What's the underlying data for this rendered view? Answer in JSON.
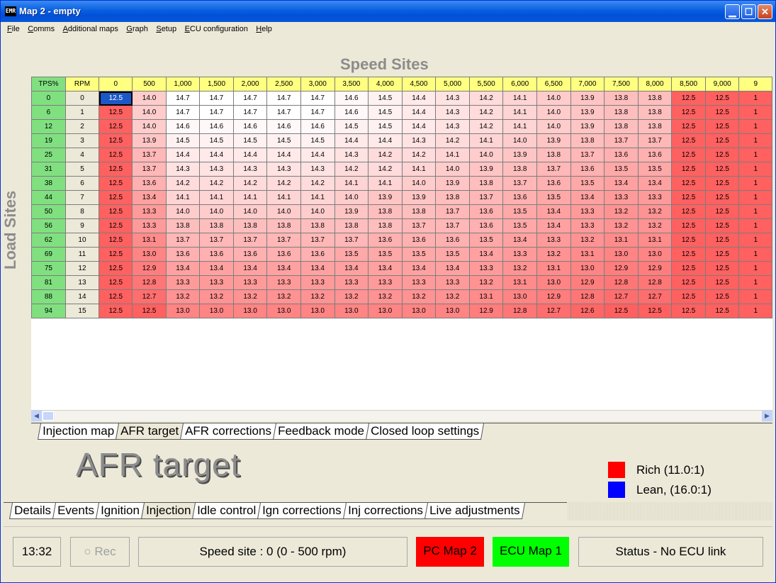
{
  "window": {
    "title": "Map 2 - empty",
    "icon_label": "EMR"
  },
  "menu": [
    "File",
    "Comms",
    "Additional maps",
    "Graph",
    "Setup",
    "ECU configuration",
    "Help"
  ],
  "headings": {
    "speed_sites": "Speed Sites",
    "load_sites": "Load Sites",
    "map_title": "AFR target"
  },
  "table": {
    "corner_tps": "TPS%",
    "corner_rpm": "RPM",
    "columns": [
      "0",
      "500",
      "1,000",
      "1,500",
      "2,000",
      "2,500",
      "3,000",
      "3,500",
      "4,000",
      "4,500",
      "5,000",
      "5,500",
      "6,000",
      "6,500",
      "7,000",
      "7,500",
      "8,000",
      "8,500",
      "9,000",
      "9"
    ],
    "rows": [
      {
        "tps": "0",
        "rpm": "0",
        "vals": [
          "12.5",
          "14.0",
          "14.7",
          "14.7",
          "14.7",
          "14.7",
          "14.7",
          "14.6",
          "14.5",
          "14.4",
          "14.3",
          "14.2",
          "14.1",
          "14.0",
          "13.9",
          "13.8",
          "13.8",
          "12.5",
          "12.5",
          "1"
        ]
      },
      {
        "tps": "6",
        "rpm": "1",
        "vals": [
          "12.5",
          "14.0",
          "14.7",
          "14.7",
          "14.7",
          "14.7",
          "14.7",
          "14.6",
          "14.5",
          "14.4",
          "14.3",
          "14.2",
          "14.1",
          "14.0",
          "13.9",
          "13.8",
          "13.8",
          "12.5",
          "12.5",
          "1"
        ]
      },
      {
        "tps": "12",
        "rpm": "2",
        "vals": [
          "12.5",
          "14.0",
          "14.6",
          "14.6",
          "14.6",
          "14.6",
          "14.6",
          "14.5",
          "14.5",
          "14.4",
          "14.3",
          "14.2",
          "14.1",
          "14.0",
          "13.9",
          "13.8",
          "13.8",
          "12.5",
          "12.5",
          "1"
        ]
      },
      {
        "tps": "19",
        "rpm": "3",
        "vals": [
          "12.5",
          "13.9",
          "14.5",
          "14.5",
          "14.5",
          "14.5",
          "14.5",
          "14.4",
          "14.4",
          "14.3",
          "14.2",
          "14.1",
          "14.0",
          "13.9",
          "13.8",
          "13.7",
          "13.7",
          "12.5",
          "12.5",
          "1"
        ]
      },
      {
        "tps": "25",
        "rpm": "4",
        "vals": [
          "12.5",
          "13.7",
          "14.4",
          "14.4",
          "14.4",
          "14.4",
          "14.4",
          "14.3",
          "14.2",
          "14.2",
          "14.1",
          "14.0",
          "13.9",
          "13.8",
          "13.7",
          "13.6",
          "13.6",
          "12.5",
          "12.5",
          "1"
        ]
      },
      {
        "tps": "31",
        "rpm": "5",
        "vals": [
          "12.5",
          "13.7",
          "14.3",
          "14.3",
          "14.3",
          "14.3",
          "14.3",
          "14.2",
          "14.2",
          "14.1",
          "14.0",
          "13.9",
          "13.8",
          "13.7",
          "13.6",
          "13.5",
          "13.5",
          "12.5",
          "12.5",
          "1"
        ]
      },
      {
        "tps": "38",
        "rpm": "6",
        "vals": [
          "12.5",
          "13.6",
          "14.2",
          "14.2",
          "14.2",
          "14.2",
          "14.2",
          "14.1",
          "14.1",
          "14.0",
          "13.9",
          "13.8",
          "13.7",
          "13.6",
          "13.5",
          "13.4",
          "13.4",
          "12.5",
          "12.5",
          "1"
        ]
      },
      {
        "tps": "44",
        "rpm": "7",
        "vals": [
          "12.5",
          "13.4",
          "14.1",
          "14.1",
          "14.1",
          "14.1",
          "14.1",
          "14.0",
          "13.9",
          "13.9",
          "13.8",
          "13.7",
          "13.6",
          "13.5",
          "13.4",
          "13.3",
          "13.3",
          "12.5",
          "12.5",
          "1"
        ]
      },
      {
        "tps": "50",
        "rpm": "8",
        "vals": [
          "12.5",
          "13.3",
          "14.0",
          "14.0",
          "14.0",
          "14.0",
          "14.0",
          "13.9",
          "13.8",
          "13.8",
          "13.7",
          "13.6",
          "13.5",
          "13.4",
          "13.3",
          "13.2",
          "13.2",
          "12.5",
          "12.5",
          "1"
        ]
      },
      {
        "tps": "56",
        "rpm": "9",
        "vals": [
          "12.5",
          "13.3",
          "13.8",
          "13.8",
          "13.8",
          "13.8",
          "13.8",
          "13.8",
          "13.8",
          "13.7",
          "13.7",
          "13.6",
          "13.5",
          "13.4",
          "13.3",
          "13.2",
          "13.2",
          "12.5",
          "12.5",
          "1"
        ]
      },
      {
        "tps": "62",
        "rpm": "10",
        "vals": [
          "12.5",
          "13.1",
          "13.7",
          "13.7",
          "13.7",
          "13.7",
          "13.7",
          "13.7",
          "13.6",
          "13.6",
          "13.6",
          "13.5",
          "13.4",
          "13.3",
          "13.2",
          "13.1",
          "13.1",
          "12.5",
          "12.5",
          "1"
        ]
      },
      {
        "tps": "69",
        "rpm": "11",
        "vals": [
          "12.5",
          "13.0",
          "13.6",
          "13.6",
          "13.6",
          "13.6",
          "13.6",
          "13.5",
          "13.5",
          "13.5",
          "13.5",
          "13.4",
          "13.3",
          "13.2",
          "13.1",
          "13.0",
          "13.0",
          "12.5",
          "12.5",
          "1"
        ]
      },
      {
        "tps": "75",
        "rpm": "12",
        "vals": [
          "12.5",
          "12.9",
          "13.4",
          "13.4",
          "13.4",
          "13.4",
          "13.4",
          "13.4",
          "13.4",
          "13.4",
          "13.4",
          "13.3",
          "13.2",
          "13.1",
          "13.0",
          "12.9",
          "12.9",
          "12.5",
          "12.5",
          "1"
        ]
      },
      {
        "tps": "81",
        "rpm": "13",
        "vals": [
          "12.5",
          "12.8",
          "13.3",
          "13.3",
          "13.3",
          "13.3",
          "13.3",
          "13.3",
          "13.3",
          "13.3",
          "13.3",
          "13.2",
          "13.1",
          "13.0",
          "12.9",
          "12.8",
          "12.8",
          "12.5",
          "12.5",
          "1"
        ]
      },
      {
        "tps": "88",
        "rpm": "14",
        "vals": [
          "12.5",
          "12.7",
          "13.2",
          "13.2",
          "13.2",
          "13.2",
          "13.2",
          "13.2",
          "13.2",
          "13.2",
          "13.2",
          "13.1",
          "13.0",
          "12.9",
          "12.8",
          "12.7",
          "12.7",
          "12.5",
          "12.5",
          "1"
        ]
      },
      {
        "tps": "94",
        "rpm": "15",
        "vals": [
          "12.5",
          "12.5",
          "13.0",
          "13.0",
          "13.0",
          "13.0",
          "13.0",
          "13.0",
          "13.0",
          "13.0",
          "13.0",
          "12.9",
          "12.8",
          "12.7",
          "12.6",
          "12.5",
          "12.5",
          "12.5",
          "12.5",
          "1"
        ]
      }
    ]
  },
  "map_tabs": [
    "Injection map",
    "AFR target",
    "AFR corrections",
    "Feedback mode",
    "Closed loop settings"
  ],
  "map_tabs_active": 1,
  "main_tabs": [
    "Details",
    "Events",
    "Ignition",
    "Injection",
    "Idle control",
    "Ign corrections",
    "Inj corrections",
    "Live adjustments"
  ],
  "main_tabs_active": 3,
  "legend": {
    "rich_label": "Rich (11.0:1)",
    "lean_label": "Lean, (16.0:1)",
    "rich_color": "#FF0000",
    "lean_color": "#0000FF"
  },
  "status": {
    "time": "13:32",
    "rec_label": "Rec",
    "speed_site": "Speed site : 0 (0 - 500 rpm)",
    "pc_map": "PC Map 2",
    "ecu_map": "ECU Map 1",
    "link_status": "Status - No ECU link",
    "pc_map_color": "#FF0000",
    "ecu_map_color": "#00FF00"
  }
}
